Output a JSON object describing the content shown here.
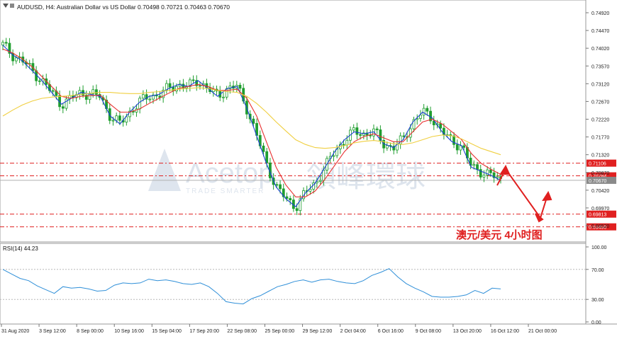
{
  "header": {
    "symbol_line": "AUDUSD, H4:  Australian Dollar vs US Dollar  0.70498 0.70721 0.70463 0.70670"
  },
  "watermark": {
    "brand": "Acetop",
    "chinese": "領峰環球",
    "tagline": "TRADE SMARTER"
  },
  "annotation": {
    "text": "澳元/美元  4小时图",
    "color": "#e02020"
  },
  "rsi_panel": {
    "label": "RSI(14) 44.23",
    "levels": [
      70,
      30
    ],
    "ticks": [
      "100.00",
      "70.00",
      "30.00",
      "0.00"
    ]
  },
  "colors": {
    "bull_candle": "#1f9e2f",
    "bear_candle": "#1f9e2f",
    "ma_fast": "#1a3fd4",
    "ma_mid": "#e83030",
    "ma_slow": "#f0cf40",
    "rsi_line": "#2f8fd8",
    "level_line": "#e02020",
    "arrow": "#e02020"
  },
  "chart_data": {
    "type": "line",
    "title": "AUDUSD, H4",
    "price_axis": {
      "ticks": [
        "0.74920",
        "0.74470",
        "0.74020",
        "0.73570",
        "0.73120",
        "0.72670",
        "0.72220",
        "0.71770",
        "0.71320",
        "0.70870",
        "0.70420",
        "0.69970",
        "0.69520"
      ],
      "ylim": [
        0.693,
        0.751
      ]
    },
    "time_axis": {
      "labels": [
        "31 Aug 2020",
        "3 Sep 12:00",
        "8 Sep 00:00",
        "10 Sep 16:00",
        "15 Sep 04:00",
        "17 Sep 20:00",
        "22 Sep 08:00",
        "25 Sep 00:00",
        "29 Sep 12:00",
        "2 Oct 04:00",
        "6 Oct 16:00",
        "9 Oct 08:00",
        "13 Oct 20:00",
        "16 Oct 12:00",
        "21 Oct 00:00"
      ]
    },
    "horizontal_levels": [
      {
        "value": 0.71106,
        "label": "0.71106"
      },
      {
        "value": 0.70784,
        "label": "0.70784"
      },
      {
        "value": 0.7067,
        "label": "0.70670"
      },
      {
        "value": 0.69813,
        "label": "0.69813"
      },
      {
        "value": 0.6949,
        "label": "0.69490"
      }
    ],
    "series": [
      {
        "values": [
          0.741,
          0.7385,
          0.737,
          0.7345,
          0.732,
          0.729,
          0.726,
          0.7275,
          0.729,
          0.7285,
          0.728,
          0.723,
          0.721,
          0.724,
          0.7265,
          0.728,
          0.7285,
          0.73,
          0.731,
          0.7305,
          0.732,
          0.73,
          0.728,
          0.73,
          0.7305,
          0.725,
          0.718,
          0.711,
          0.705,
          0.702,
          0.7,
          0.7035,
          0.706,
          0.71,
          0.714,
          0.717,
          0.719,
          0.7185,
          0.719,
          0.716,
          0.715,
          0.717,
          0.7215,
          0.724,
          0.7225,
          0.719,
          0.7165,
          0.7155,
          0.71,
          0.709,
          0.708,
          0.7067
        ]
      },
      {
        "values": [
          0.74,
          0.739,
          0.7375,
          0.7355,
          0.733,
          0.7305,
          0.728,
          0.7275,
          0.728,
          0.7282,
          0.7283,
          0.726,
          0.724,
          0.724,
          0.7248,
          0.7262,
          0.7275,
          0.7288,
          0.73,
          0.7305,
          0.731,
          0.7305,
          0.7295,
          0.7295,
          0.7298,
          0.7275,
          0.723,
          0.7165,
          0.71,
          0.7055,
          0.7025,
          0.7025,
          0.704,
          0.707,
          0.7105,
          0.714,
          0.7165,
          0.7178,
          0.7185,
          0.7175,
          0.7165,
          0.7165,
          0.719,
          0.7215,
          0.7222,
          0.721,
          0.719,
          0.717,
          0.7135,
          0.711,
          0.7095,
          0.7082
        ]
      },
      {
        "values": [
          0.723,
          0.7245,
          0.7258,
          0.7268,
          0.7275,
          0.7278,
          0.728,
          0.7282,
          0.7285,
          0.7288,
          0.729,
          0.729,
          0.7288,
          0.7287,
          0.7287,
          0.729,
          0.7292,
          0.7295,
          0.7298,
          0.73,
          0.7302,
          0.73,
          0.7295,
          0.7292,
          0.729,
          0.728,
          0.7262,
          0.724,
          0.7215,
          0.7192,
          0.717,
          0.7158,
          0.715,
          0.7148,
          0.715,
          0.7155,
          0.7162,
          0.7166,
          0.7168,
          0.7165,
          0.716,
          0.7158,
          0.7162,
          0.717,
          0.7178,
          0.7182,
          0.718,
          0.7172,
          0.716,
          0.7148,
          0.714,
          0.7132
        ]
      }
    ],
    "rsi": {
      "ylim": [
        0,
        100
      ],
      "values": [
        70,
        64,
        58,
        55,
        48,
        43,
        38,
        47,
        45,
        46,
        44,
        41,
        42,
        49,
        52,
        51,
        52,
        57,
        55,
        56,
        54,
        51,
        50,
        52,
        47,
        38,
        27,
        25,
        24,
        31,
        35,
        41,
        47,
        50,
        54,
        56,
        53,
        56,
        57,
        54,
        52,
        51,
        55,
        62,
        66,
        71,
        60,
        51,
        45,
        40,
        34,
        33,
        33,
        34,
        36,
        42,
        38,
        45,
        44
      ]
    }
  }
}
